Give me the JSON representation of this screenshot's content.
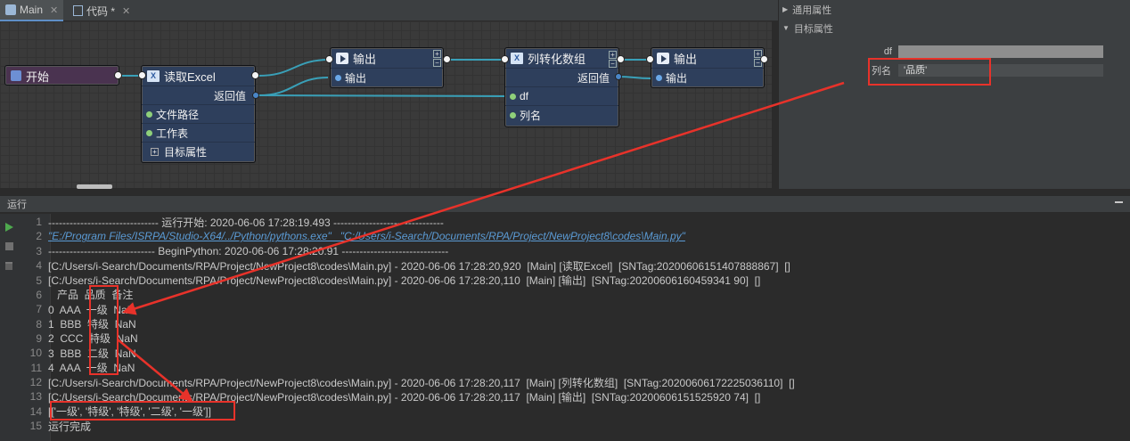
{
  "tabs": [
    {
      "label": "Main",
      "icon": "grid-icon"
    },
    {
      "label": "代码 *",
      "icon": "code-file-icon"
    }
  ],
  "nodes": {
    "start": {
      "title": "开始"
    },
    "read_excel": {
      "title": "读取Excel",
      "return_label": "返回值",
      "rows": [
        "文件路径",
        "工作表"
      ],
      "target_props": "目标属性"
    },
    "output1": {
      "title": "输出",
      "input_label": "输出"
    },
    "list_convert": {
      "title": "列转化数组",
      "return_label": "返回值",
      "rows": [
        "df",
        "列名"
      ]
    },
    "output2": {
      "title": "输出",
      "input_label": "输出"
    }
  },
  "panel": {
    "general_section": "通用属性",
    "target_section": "目标属性",
    "df_label": "df",
    "df_value": "",
    "col_label": "列名",
    "col_value": "'品质'"
  },
  "run": {
    "title": "运行",
    "lines": [
      "------------------------------- 运行开始: 2020-06-06 17:28:19.493 -------------------------------",
      "\"E:/Program Files/ISRPA/Studio-X64/../Python/pythons.exe\"   \"C:/Users/i-Search/Documents/RPA/Project/NewProject8\\codes\\Main.py\"",
      "------------------------------ BeginPython: 2020-06-06 17:28:20.91 ------------------------------",
      "[C:/Users/i-Search/Documents/RPA/Project/NewProject8\\codes\\Main.py] - 2020-06-06 17:28:20,920  [Main] [读取Excel]  [SNTag:20200606151407888867]  []",
      "[C:/Users/i-Search/Documents/RPA/Project/NewProject8\\codes\\Main.py] - 2020-06-06 17:28:20,110  [Main] [输出]  [SNTag:20200606160459341 90]  []",
      "   产品  品质  备注",
      "0  AAA  一级  NaN",
      "1  BBB  特级  NaN",
      "2  CCC  特级  NaN",
      "3  BBB  二级  NaN",
      "4  AAA  一级  NaN",
      "[C:/Users/i-Search/Documents/RPA/Project/NewProject8\\codes\\Main.py] - 2020-06-06 17:28:20,117  [Main] [列转化数组]  [SNTag:20200606172225036110]  []",
      "[C:/Users/i-Search/Documents/RPA/Project/NewProject8\\codes\\Main.py] - 2020-06-06 17:28:20,117  [Main] [输出]  [SNTag:20200606151525920 74]  []",
      "[['一级', '特级', '特级', '二级', '一级']]",
      "运行完成"
    ]
  },
  "colors": {
    "annotation": "#e8322a",
    "node_bg": "#2e3f5c",
    "start_bg": "#4a3350",
    "link": "#5b9bd5"
  }
}
